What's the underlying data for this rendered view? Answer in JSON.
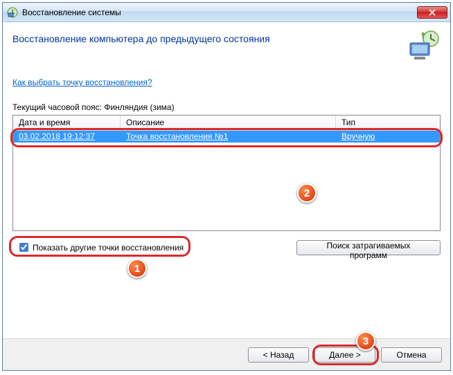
{
  "window": {
    "title": "Восстановление системы"
  },
  "page": {
    "heading": "Восстановление компьютера до предыдущего состояния",
    "help_link": "Как выбрать точку восстановления?",
    "timezone_label": "Текущий часовой пояс: Финляндия (зима)"
  },
  "table": {
    "headers": {
      "date": "Дата и время",
      "desc": "Описание",
      "type": "Тип"
    },
    "rows": [
      {
        "date": "03.02.2018 19:12:37",
        "desc": "Точка восстановления №1",
        "type": "Вручную"
      }
    ]
  },
  "controls": {
    "show_more_checkbox": "Показать другие точки восстановления",
    "show_more_checked": true,
    "search_programs": "Поиск затрагиваемых программ"
  },
  "footer": {
    "back": "< Назад",
    "next": "Далее >",
    "cancel": "Отмена"
  },
  "annotations": {
    "b1": "1",
    "b2": "2",
    "b3": "3"
  }
}
